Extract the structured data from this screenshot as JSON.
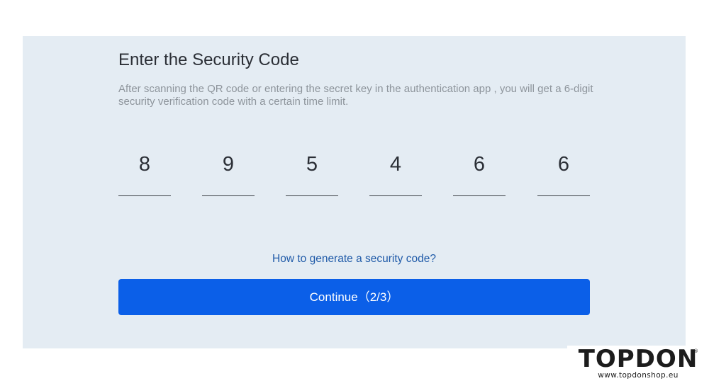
{
  "form": {
    "title": "Enter the Security Code",
    "description": "After scanning the QR code or entering the secret key in the authentication app , you will get a 6-digit security verification code with a certain time limit.",
    "code_digits": [
      "8",
      "9",
      "5",
      "4",
      "6",
      "6"
    ],
    "help_link": "How to generate a security code?",
    "continue_label": "Continue（2/3）"
  },
  "brand": {
    "logo_text": "TOPDON",
    "registered_mark": "®",
    "url": "www.topdonshop.eu"
  },
  "colors": {
    "panel_background": "#e4ecf3",
    "primary_button": "#0b5fe8",
    "link": "#1f5aa8",
    "title_text": "#2b2f36",
    "description_text": "#8e959c"
  }
}
